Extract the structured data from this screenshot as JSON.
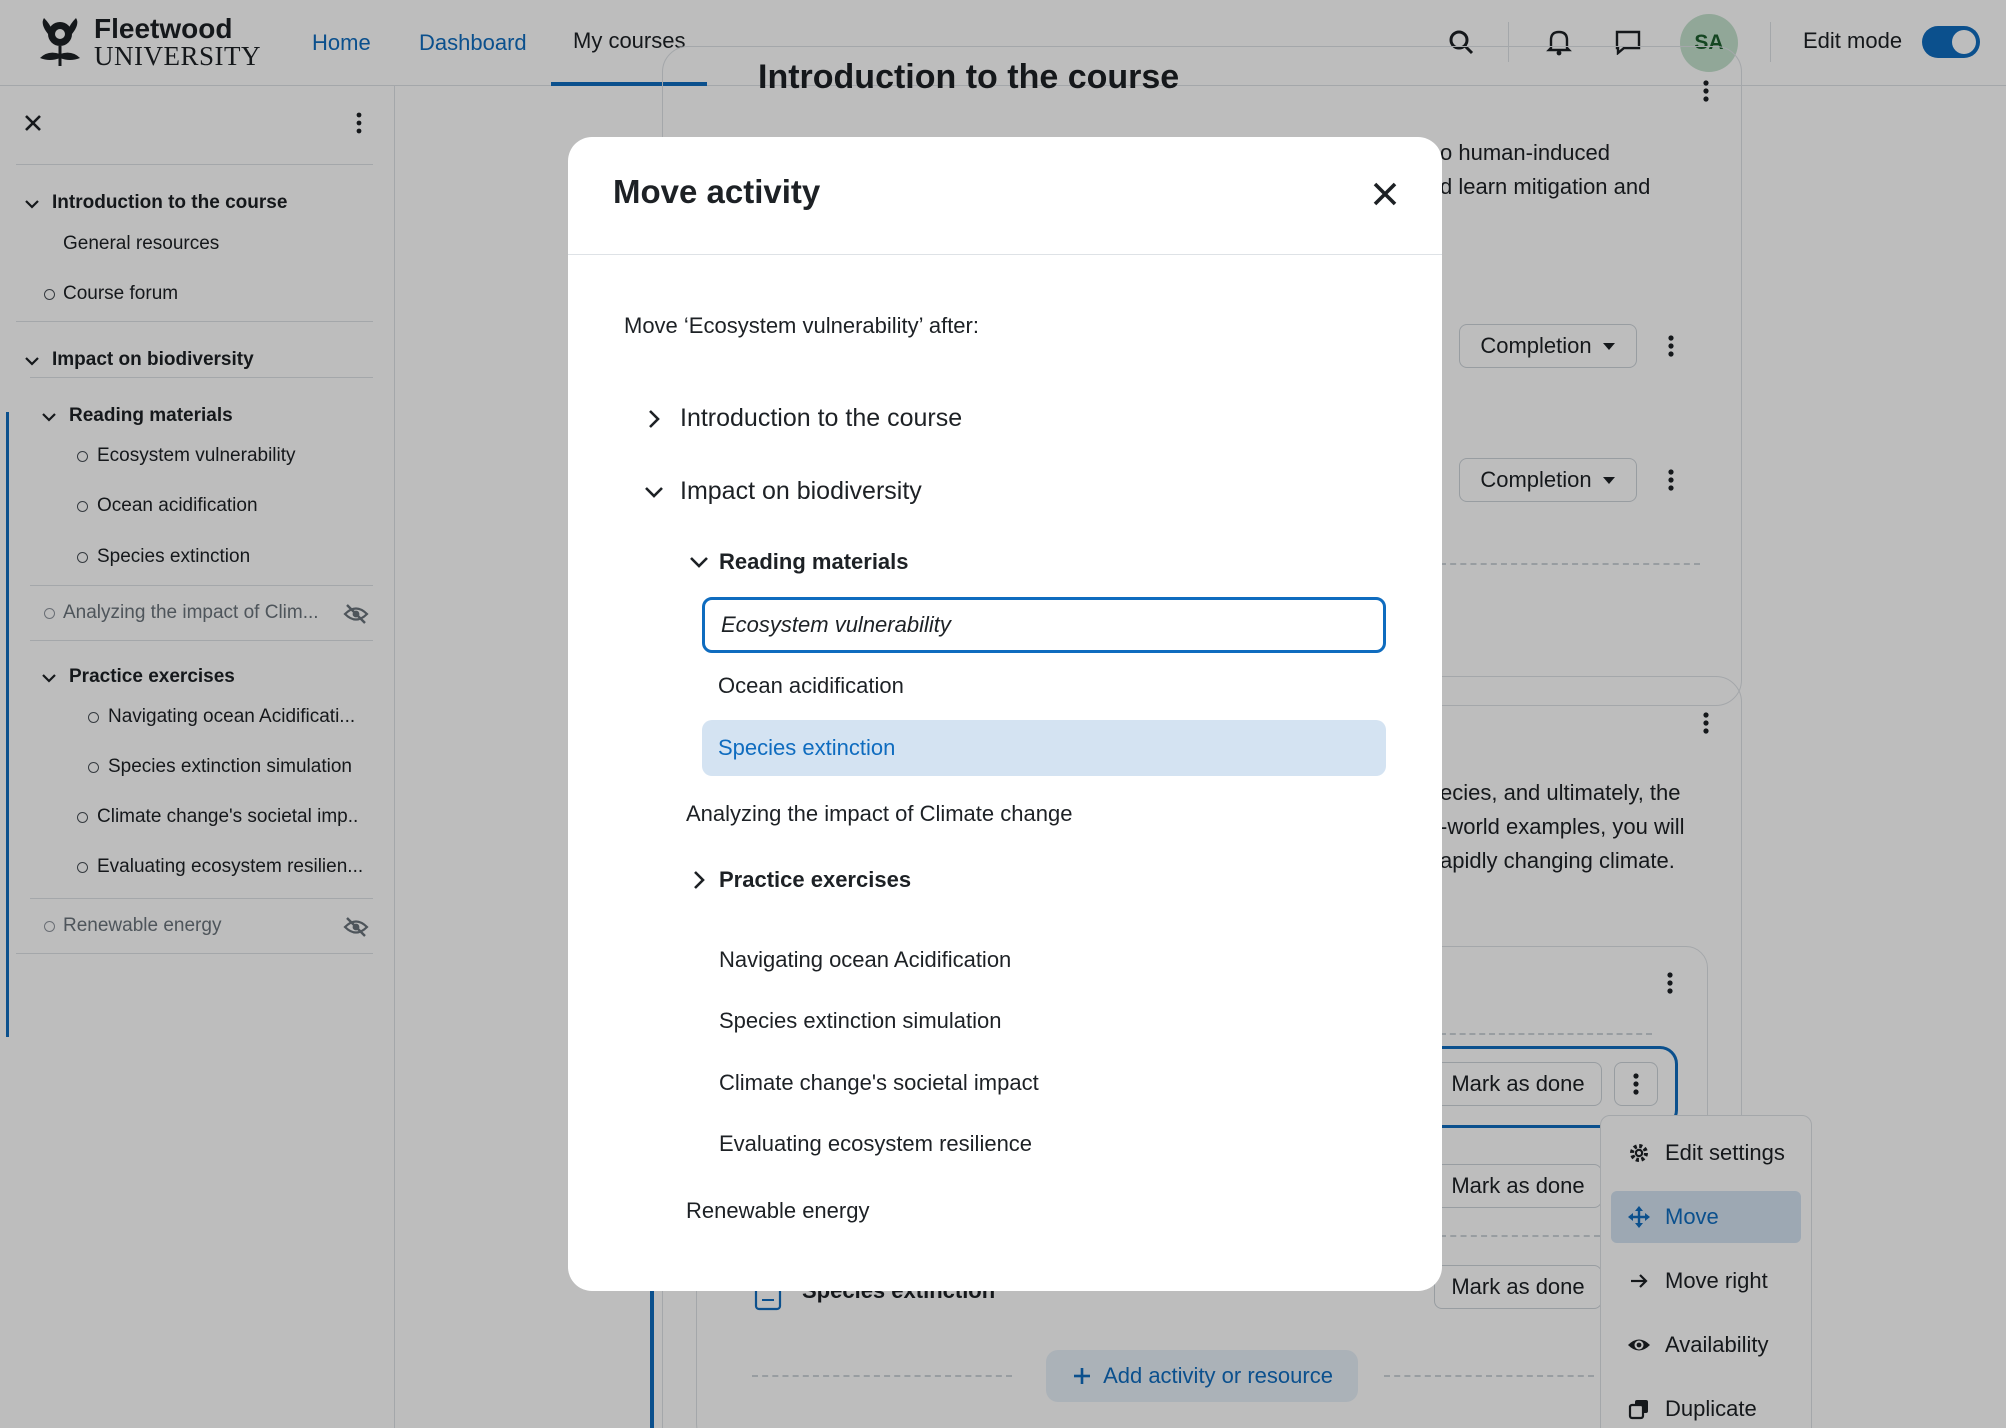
{
  "header": {
    "logo_line1": "Fleetwood",
    "logo_line2": "UNIVERSITY",
    "nav": [
      "Home",
      "Dashboard",
      "My courses"
    ],
    "active_nav": "My courses",
    "avatar_initials": "SA",
    "edit_mode_label": "Edit mode",
    "edit_mode_on": true
  },
  "drawer": {
    "items": [
      {
        "label": "Introduction to the course",
        "kind": "section"
      },
      {
        "label": "General resources",
        "kind": "subsection"
      },
      {
        "label": "Course forum",
        "kind": "activity"
      },
      {
        "label": "Impact on biodiversity",
        "kind": "section"
      },
      {
        "label": "Reading materials",
        "kind": "subsection"
      },
      {
        "label": "Ecosystem vulnerability",
        "kind": "activity"
      },
      {
        "label": "Ocean acidification",
        "kind": "activity"
      },
      {
        "label": "Species extinction",
        "kind": "activity"
      },
      {
        "label": "Analyzing the impact of Clim...",
        "kind": "activity",
        "hidden": true
      },
      {
        "label": "Practice exercises",
        "kind": "subsection"
      },
      {
        "label": "Navigating ocean Acidificati...",
        "kind": "activity"
      },
      {
        "label": "Species extinction simulation",
        "kind": "activity"
      },
      {
        "label": "Climate change's societal imp..",
        "kind": "activity"
      },
      {
        "label": "Evaluating ecosystem resilien...",
        "kind": "activity"
      },
      {
        "label": "Renewable energy",
        "kind": "section",
        "hidden": true
      }
    ]
  },
  "background": {
    "section1_title": "Introduction to the course",
    "section1_desc_line1": "o human-induced",
    "section1_desc_line2": "d learn mitigation and",
    "completion_label": "Completion",
    "section2_desc_line1": "ecies, and ultimately, the",
    "section2_desc_line2": "-world examples, you will",
    "section2_desc_line3": "apidly changing climate.",
    "mark_as_done_label": "Mark as done",
    "activity_row_label": "Species extinction",
    "add_activity_label": "Add activity or resource"
  },
  "action_menu": {
    "items": [
      "Edit settings",
      "Move",
      "Move right",
      "Availability",
      "Duplicate"
    ],
    "active": "Move"
  },
  "modal": {
    "title": "Move activity",
    "prompt": "Move ‘Ecosystem vulnerability’ after:",
    "tree": {
      "section1": "Introduction to the course",
      "section2": "Impact on biodiversity",
      "subsection1": "Reading materials",
      "current_item": "Ecosystem vulnerability",
      "item_ocean": "Ocean acidification",
      "item_species_hover": "Species extinction",
      "item_analyzing": "Analyzing the impact of Climate change",
      "subsection2": "Practice exercises",
      "item_nav": "Navigating ocean Acidification",
      "item_sim": "Species extinction simulation",
      "item_societal": "Climate change's societal impact",
      "item_eval": "Evaluating ecosystem resilience",
      "item_renewable": "Renewable energy"
    }
  },
  "colors": {
    "brand_blue": "#0f6cbf",
    "hover_bg": "#d4e3f2",
    "avatar_bg": "#c4e2cd"
  }
}
